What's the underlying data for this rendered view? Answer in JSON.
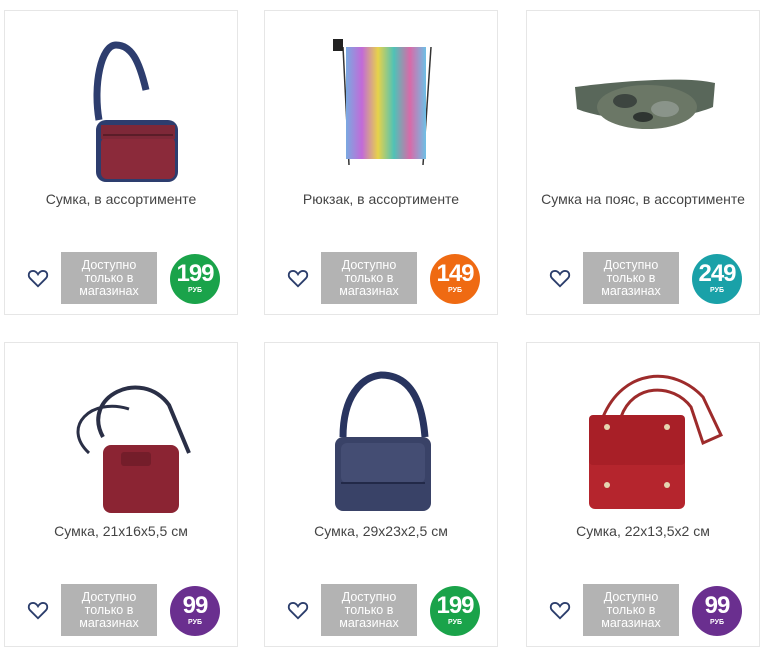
{
  "products": [
    {
      "title": "Сумка, в ассортименте",
      "availability": "Доступно только в магазинах",
      "price": "199",
      "currency": "РУБ",
      "price_color": "#1aa34a",
      "image": "shoulder-bag-image"
    },
    {
      "title": "Рюкзак, в ассортименте",
      "availability": "Доступно только в магазинах",
      "price": "149",
      "currency": "РУБ",
      "price_color": "#ef6a12",
      "image": "drawstring-backpack-image"
    },
    {
      "title": "Сумка на пояс, в ассортименте",
      "availability": "Доступно только в магазинах",
      "price": "249",
      "currency": "РУБ",
      "price_color": "#1aa1a8",
      "image": "waist-bag-image"
    },
    {
      "title": "Сумка, 21х16х5,5 см",
      "availability": "Доступно только в магазинах",
      "price": "99",
      "currency": "РУБ",
      "price_color": "#6a2f8f",
      "image": "burgundy-bucket-bag-image"
    },
    {
      "title": "Сумка, 29х23х2,5 см",
      "availability": "Доступно только в магазинах",
      "price": "199",
      "currency": "РУБ",
      "price_color": "#1aa34a",
      "image": "navy-messenger-bag-image"
    },
    {
      "title": "Сумка, 22х13,5х2 см",
      "availability": "Доступно только в магазинах",
      "price": "99",
      "currency": "РУБ",
      "price_color": "#6a2f8f",
      "image": "red-flap-bag-image"
    }
  ]
}
